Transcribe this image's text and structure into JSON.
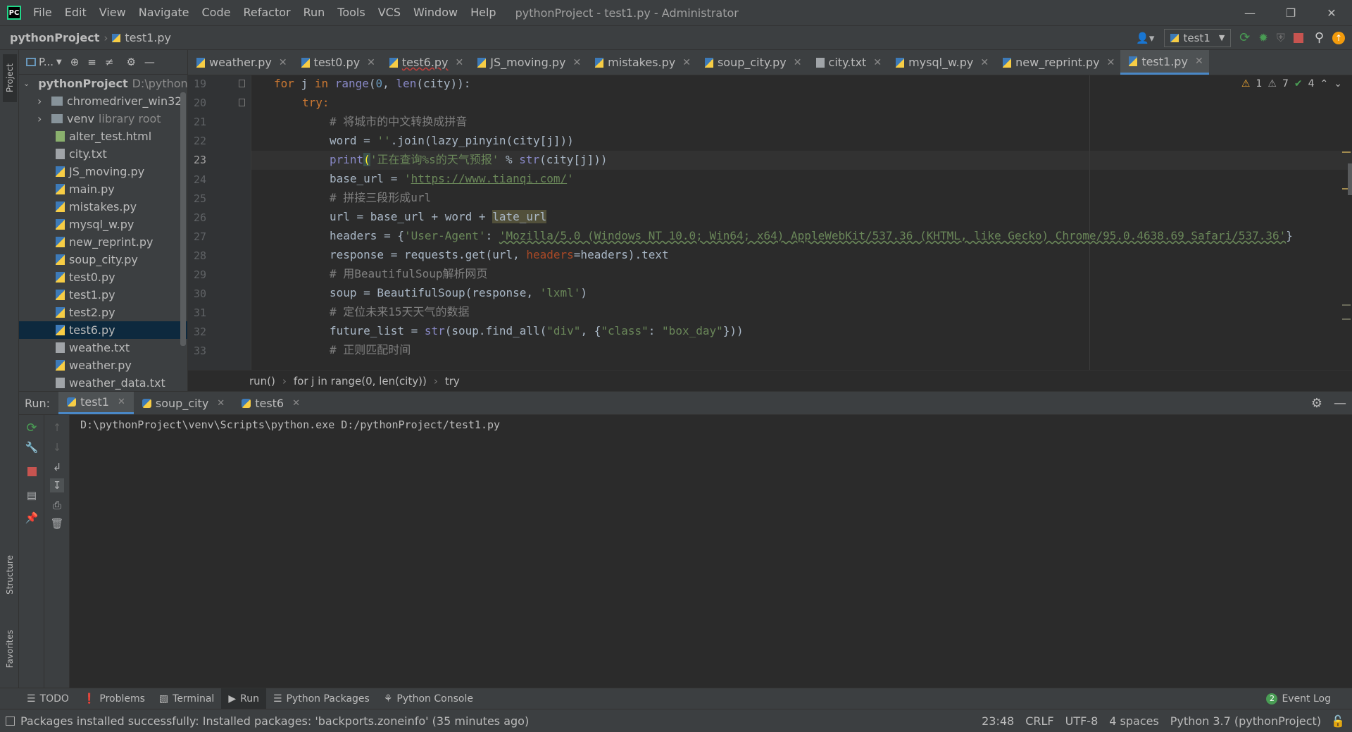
{
  "window": {
    "title": "pythonProject - test1.py - Administrator",
    "menu": [
      "File",
      "Edit",
      "View",
      "Navigate",
      "Code",
      "Refactor",
      "Run",
      "Tools",
      "VCS",
      "Window",
      "Help"
    ]
  },
  "nav": {
    "project": "pythonProject",
    "file": "test1.py",
    "run_config": "test1"
  },
  "sidebar": {
    "project_label": "Project",
    "structure_label": "Structure",
    "favorites_label": "Favorites",
    "panel_title": "P...",
    "root_name": "pythonProject",
    "root_path": "D:\\pythonProject",
    "items": [
      {
        "label": "chromedriver_win32",
        "type": "folder"
      },
      {
        "label": "venv",
        "type": "folder",
        "suffix": "library root"
      },
      {
        "label": "alter_test.html",
        "type": "html"
      },
      {
        "label": "city.txt",
        "type": "txt"
      },
      {
        "label": "JS_moving.py",
        "type": "py"
      },
      {
        "label": "main.py",
        "type": "py"
      },
      {
        "label": "mistakes.py",
        "type": "py"
      },
      {
        "label": "mysql_w.py",
        "type": "py"
      },
      {
        "label": "new_reprint.py",
        "type": "py"
      },
      {
        "label": "soup_city.py",
        "type": "py"
      },
      {
        "label": "test0.py",
        "type": "py"
      },
      {
        "label": "test1.py",
        "type": "py"
      },
      {
        "label": "test2.py",
        "type": "py"
      },
      {
        "label": "test6.py",
        "type": "py",
        "selected": true
      },
      {
        "label": "weathe.txt",
        "type": "txt"
      },
      {
        "label": "weather.py",
        "type": "py"
      },
      {
        "label": "weather_data.txt",
        "type": "txt"
      }
    ]
  },
  "tabs": [
    "weather.py",
    "test0.py",
    "test6.py",
    "JS_moving.py",
    "mistakes.py",
    "soup_city.py",
    "city.txt",
    "mysql_w.py",
    "new_reprint.py",
    "test1.py"
  ],
  "editor": {
    "inspections": {
      "warnings": "1",
      "weak": "7",
      "ok": "4"
    },
    "line_numbers": [
      "19",
      "20",
      "21",
      "22",
      "23",
      "24",
      "25",
      "26",
      "27",
      "28",
      "29",
      "30",
      "31",
      "32",
      "33"
    ],
    "code": {
      "l19_for": "for",
      "l19_j": " j ",
      "l19_in": "in",
      "l19_range": " range",
      "l19_a": "(",
      "l19_num": "0",
      "l19_b": ", ",
      "l19_len": "len",
      "l19_c": "(city)):",
      "l20_try": "try:",
      "l21": "# 将城市的中文转换成拼音",
      "l22_a": "word = ",
      "l22_s": "''",
      "l22_b": ".join(lazy_pinyin(city[j]))",
      "l23_print": "print",
      "l23_a": "(",
      "l23_s": "'正在查询%s的天气预报'",
      "l23_b": " % ",
      "l23_str": "str",
      "l23_c": "(city[j]))",
      "l24_a": "base_url = ",
      "l24_q1": "'",
      "l24_url": "https://www.tianqi.com/",
      "l24_q2": "'",
      "l25": "# 拼接三段形成url",
      "l26_a": "url = base_url + word + ",
      "l26_b": "late_url",
      "l27_a": "headers = {",
      "l27_k": "'User-Agent'",
      "l27_b": ": ",
      "l27_v": "'Mozilla/5.0 (Windows NT 10.0; Win64; x64) AppleWebKit/537.36 (KHTML, like Gecko) Chrome/95.0.4638.69 Safari/537.36'",
      "l27_c": "}",
      "l28_a": "response = requests.get(url, ",
      "l28_p": "headers",
      "l28_b": "=headers).text",
      "l29": "# 用BeautifulSoup解析网页",
      "l30_a": "soup = BeautifulSoup(response, ",
      "l30_s": "'lxml'",
      "l30_b": ")",
      "l31": "# 定位未来15天天气的数据",
      "l32_a": "future_list = ",
      "l32_str": "str",
      "l32_b": "(soup.find_all(",
      "l32_s1": "\"div\"",
      "l32_c": ", {",
      "l32_s2": "\"class\"",
      "l32_d": ": ",
      "l32_s3": "\"box_day\"",
      "l32_e": "}))",
      "l33": "# 正则匹配时间"
    }
  },
  "breadcrumb": [
    "run()",
    "for j in range(0, len(city))",
    "try"
  ],
  "run": {
    "label": "Run:",
    "tabs": [
      "test1",
      "soup_city",
      "test6"
    ],
    "output": "D:\\pythonProject\\venv\\Scripts\\python.exe D:/pythonProject/test1.py"
  },
  "toolwindows": {
    "todo": "TODO",
    "problems": "Problems",
    "terminal": "Terminal",
    "run": "Run",
    "packages": "Python Packages",
    "console": "Python Console",
    "event_log_count": "2",
    "event_log": "Event Log"
  },
  "status": {
    "message": "Packages installed successfully: Installed packages: 'backports.zoneinfo' (35 minutes ago)",
    "position": "23:48",
    "line_sep": "CRLF",
    "encoding": "UTF-8",
    "indent": "4 spaces",
    "interpreter": "Python 3.7 (pythonProject)"
  },
  "colors": {
    "accent": "#4a88c7",
    "keyword": "#cc7832",
    "string": "#6a8759",
    "comment": "#808080",
    "run_green": "#499c54",
    "stop_red": "#c75450"
  }
}
